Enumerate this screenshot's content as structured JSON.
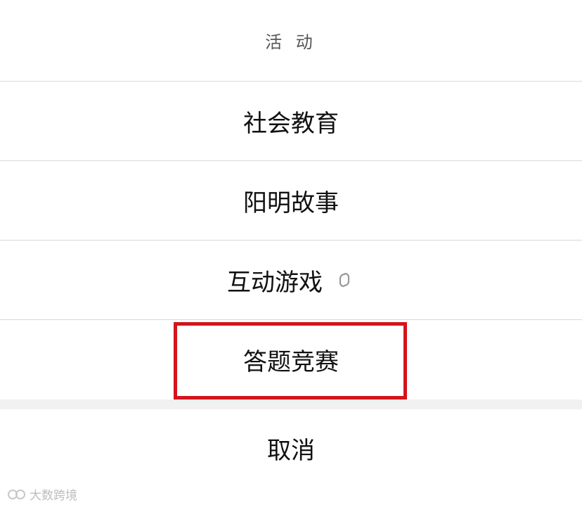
{
  "sheet": {
    "title": "活 动",
    "options": [
      {
        "label": "社会教育"
      },
      {
        "label": "阳明故事"
      },
      {
        "label": "互动游戏",
        "icon": "mini-program-link-icon"
      },
      {
        "label": "答题竞赛",
        "highlighted": true
      }
    ],
    "cancel_label": "取消"
  },
  "highlight": {
    "color": "#d4141b"
  },
  "watermark": {
    "text": "大数跨境"
  }
}
